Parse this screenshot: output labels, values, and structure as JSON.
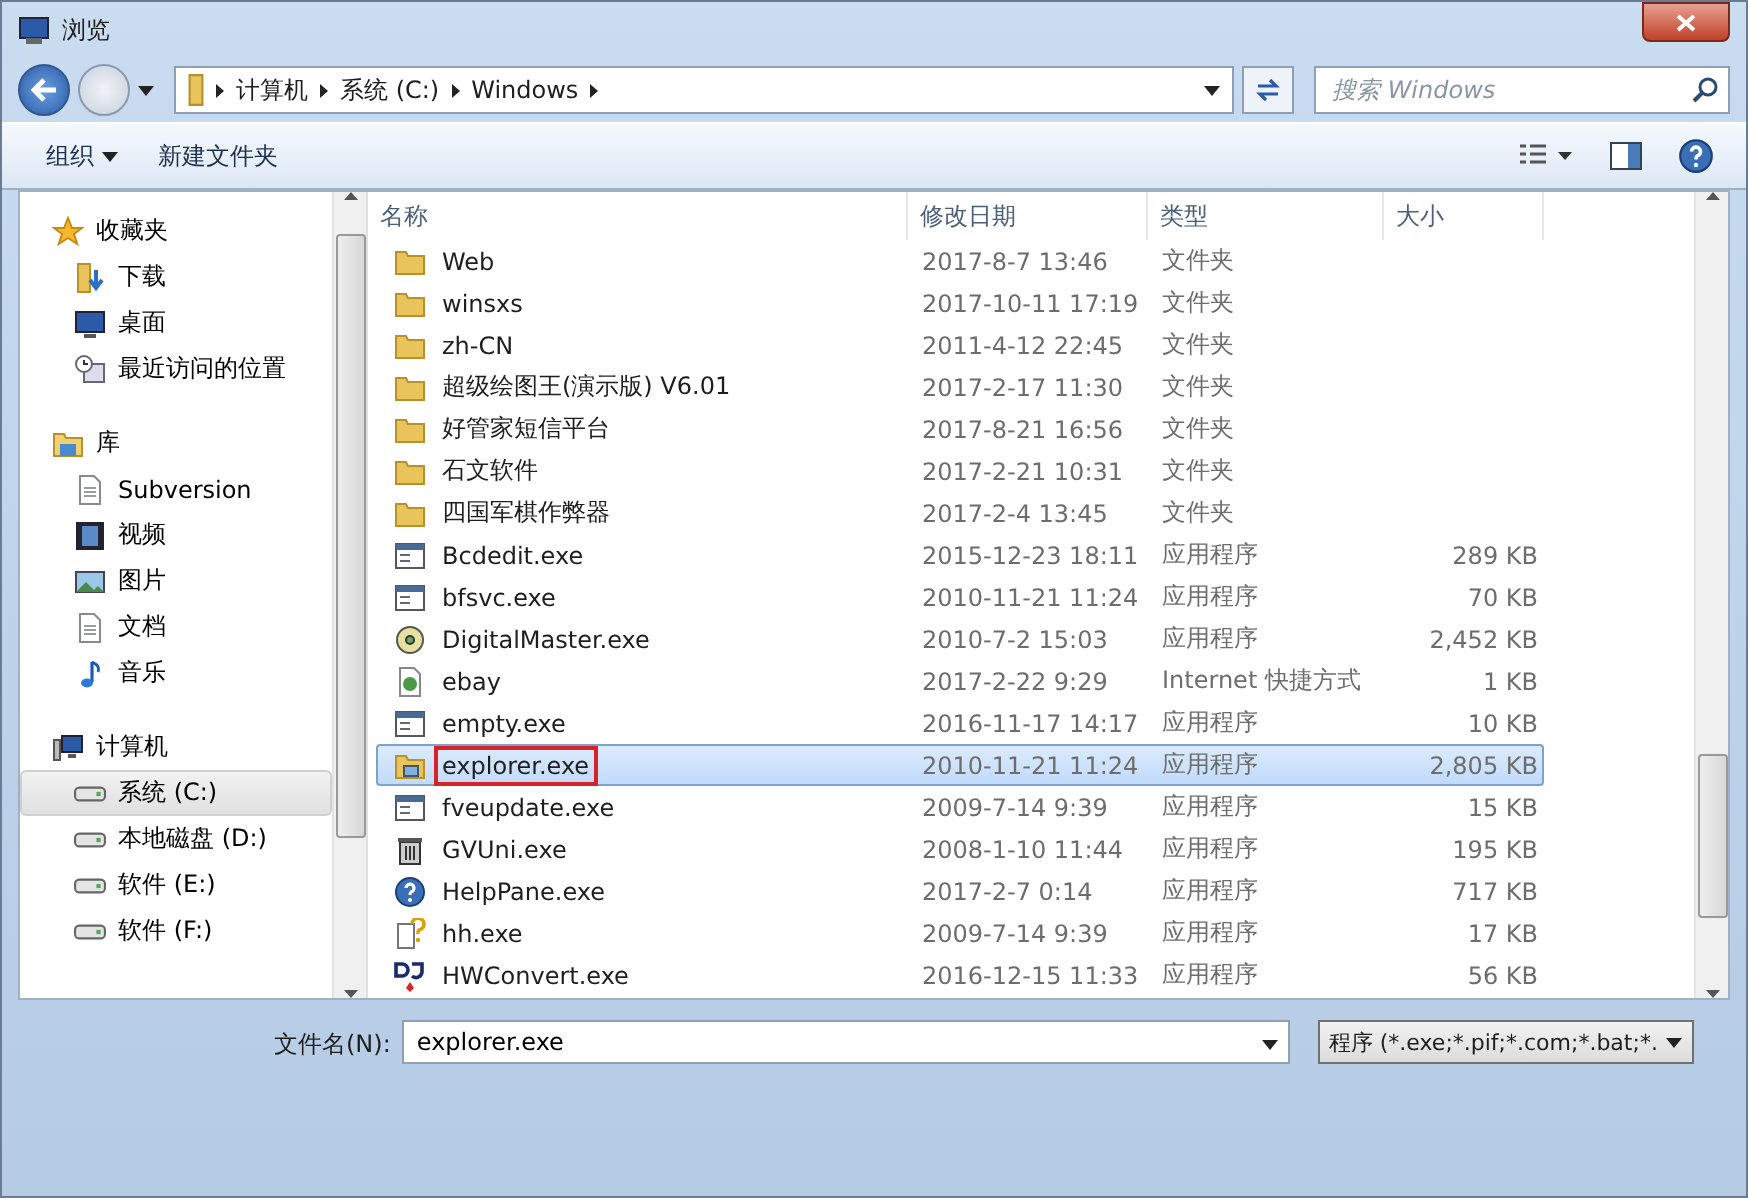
{
  "window": {
    "title": "浏览"
  },
  "address": {
    "crumbs": [
      "计算机",
      "系统 (C:)",
      "Windows"
    ]
  },
  "search": {
    "placeholder": "搜索 Windows"
  },
  "toolbar": {
    "buttons": [
      "组织",
      "新建文件夹"
    ]
  },
  "sidebar": {
    "groups": [
      {
        "label": "收藏夹",
        "kind": "star",
        "children": [
          {
            "label": "下载",
            "kind": "download",
            "selected": false
          },
          {
            "label": "桌面",
            "kind": "desktop",
            "selected": false
          },
          {
            "label": "最近访问的位置",
            "kind": "recent",
            "selected": false
          }
        ]
      },
      {
        "label": "库",
        "kind": "library",
        "children": [
          {
            "label": "Subversion",
            "kind": "doc",
            "selected": false
          },
          {
            "label": "视频",
            "kind": "video",
            "selected": false
          },
          {
            "label": "图片",
            "kind": "picture",
            "selected": false
          },
          {
            "label": "文档",
            "kind": "doc",
            "selected": false
          },
          {
            "label": "音乐",
            "kind": "music",
            "selected": false
          }
        ]
      },
      {
        "label": "计算机",
        "kind": "computer",
        "children": [
          {
            "label": "系统 (C:)",
            "kind": "drive",
            "selected": true
          },
          {
            "label": "本地磁盘 (D:)",
            "kind": "drive",
            "selected": false
          },
          {
            "label": "软件 (E:)",
            "kind": "drive",
            "selected": false
          },
          {
            "label": "软件 (F:)",
            "kind": "drive",
            "selected": false
          }
        ]
      }
    ]
  },
  "table": {
    "columns": [
      "名称",
      "修改日期",
      "类型",
      "大小"
    ],
    "rows": [
      {
        "name": "Web",
        "date": "2017-8-7 13:46",
        "type": "文件夹",
        "size": "",
        "kind": "folder",
        "selected": false,
        "outlined": false
      },
      {
        "name": "winsxs",
        "date": "2017-10-11 17:19",
        "type": "文件夹",
        "size": "",
        "kind": "folder",
        "selected": false,
        "outlined": false
      },
      {
        "name": "zh-CN",
        "date": "2011-4-12 22:45",
        "type": "文件夹",
        "size": "",
        "kind": "folder",
        "selected": false,
        "outlined": false
      },
      {
        "name": "超级绘图王(演示版) V6.01",
        "date": "2017-2-17 11:30",
        "type": "文件夹",
        "size": "",
        "kind": "folder",
        "selected": false,
        "outlined": false
      },
      {
        "name": "好管家短信平台",
        "date": "2017-8-21 16:56",
        "type": "文件夹",
        "size": "",
        "kind": "folder",
        "selected": false,
        "outlined": false
      },
      {
        "name": "石文软件",
        "date": "2017-2-21 10:31",
        "type": "文件夹",
        "size": "",
        "kind": "folder",
        "selected": false,
        "outlined": false
      },
      {
        "name": "四国军棋作弊器",
        "date": "2017-2-4 13:45",
        "type": "文件夹",
        "size": "",
        "kind": "folder",
        "selected": false,
        "outlined": false
      },
      {
        "name": "Bcdedit.exe",
        "date": "2015-12-23 18:11",
        "type": "应用程序",
        "size": "289 KB",
        "kind": "app",
        "selected": false,
        "outlined": false
      },
      {
        "name": "bfsvc.exe",
        "date": "2010-11-21 11:24",
        "type": "应用程序",
        "size": "70 KB",
        "kind": "app",
        "selected": false,
        "outlined": false
      },
      {
        "name": "DigitalMaster.exe",
        "date": "2010-7-2 15:03",
        "type": "应用程序",
        "size": "2,452 KB",
        "kind": "disc",
        "selected": false,
        "outlined": false
      },
      {
        "name": "ebay",
        "date": "2017-2-22 9:29",
        "type": "Internet 快捷方式",
        "size": "1 KB",
        "kind": "shortcut",
        "selected": false,
        "outlined": false
      },
      {
        "name": "empty.exe",
        "date": "2016-11-17 14:17",
        "type": "应用程序",
        "size": "10 KB",
        "kind": "app",
        "selected": false,
        "outlined": false
      },
      {
        "name": "explorer.exe",
        "date": "2010-11-21 11:24",
        "type": "应用程序",
        "size": "2,805 KB",
        "kind": "folder-app",
        "selected": true,
        "outlined": true
      },
      {
        "name": "fveupdate.exe",
        "date": "2009-7-14 9:39",
        "type": "应用程序",
        "size": "15 KB",
        "kind": "app",
        "selected": false,
        "outlined": false
      },
      {
        "name": "GVUni.exe",
        "date": "2008-1-10 11:44",
        "type": "应用程序",
        "size": "195 KB",
        "kind": "bin",
        "selected": false,
        "outlined": false
      },
      {
        "name": "HelpPane.exe",
        "date": "2017-2-7 0:14",
        "type": "应用程序",
        "size": "717 KB",
        "kind": "help",
        "selected": false,
        "outlined": false
      },
      {
        "name": "hh.exe",
        "date": "2009-7-14 9:39",
        "type": "应用程序",
        "size": "17 KB",
        "kind": "help-doc",
        "selected": false,
        "outlined": false
      },
      {
        "name": "HWConvert.exe",
        "date": "2016-12-15 11:33",
        "type": "应用程序",
        "size": "56 KB",
        "kind": "dj",
        "selected": false,
        "outlined": false
      }
    ]
  },
  "footer": {
    "filename_label": "文件名(N):",
    "filename": "explorer.exe",
    "filter": "程序 (*.exe;*.pif;*.com;*.bat;*."
  }
}
